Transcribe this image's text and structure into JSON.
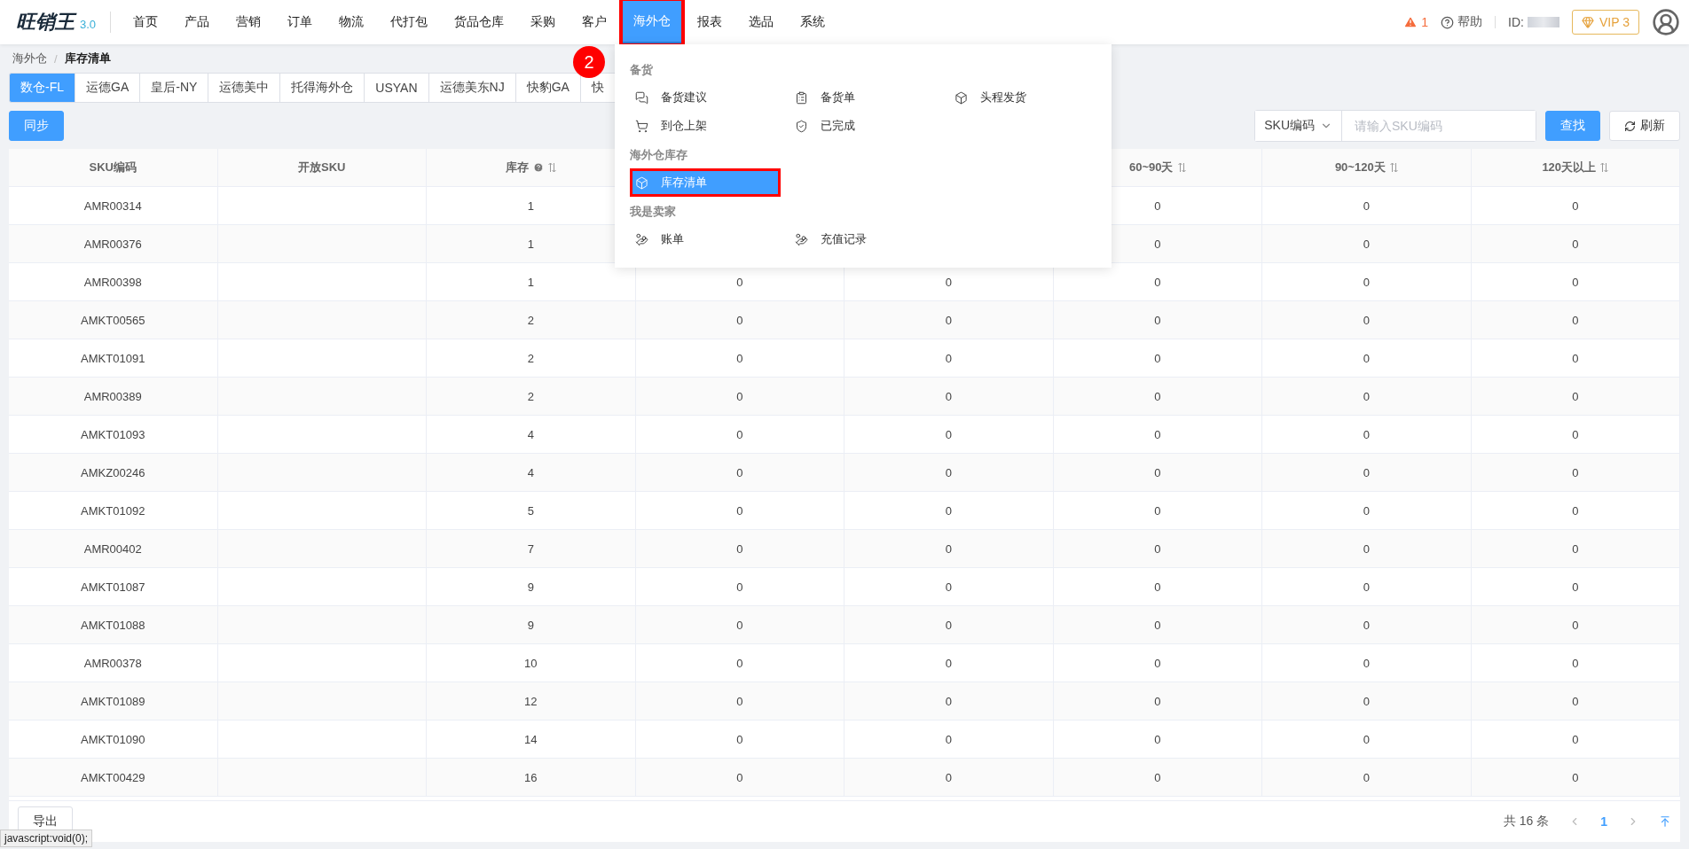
{
  "logo": {
    "name": "旺销王",
    "version": "3.0"
  },
  "nav": [
    {
      "label": "首页",
      "selected": false,
      "annotated": false
    },
    {
      "label": "产品",
      "selected": false,
      "annotated": false
    },
    {
      "label": "营销",
      "selected": false,
      "annotated": false
    },
    {
      "label": "订单",
      "selected": false,
      "annotated": false
    },
    {
      "label": "物流",
      "selected": false,
      "annotated": false
    },
    {
      "label": "代打包",
      "selected": false,
      "annotated": false
    },
    {
      "label": "货品仓库",
      "selected": false,
      "annotated": false
    },
    {
      "label": "采购",
      "selected": false,
      "annotated": false
    },
    {
      "label": "客户",
      "selected": false,
      "annotated": false
    },
    {
      "label": "海外仓",
      "selected": true,
      "annotated": true
    },
    {
      "label": "报表",
      "selected": false,
      "annotated": false
    },
    {
      "label": "选品",
      "selected": false,
      "annotated": false
    },
    {
      "label": "系统",
      "selected": false,
      "annotated": false
    }
  ],
  "annotation_badge": "2",
  "header_right": {
    "alert_count": "1",
    "help": "帮助",
    "id_label": "ID:",
    "vip": "VIP 3"
  },
  "breadcrumb": {
    "items": [
      "海外仓",
      "库存清单"
    ],
    "separator": "/"
  },
  "warehouse_tabs": [
    {
      "label": "数仓-FL",
      "selected": true
    },
    {
      "label": "运德GA",
      "selected": false
    },
    {
      "label": "皇后-NY",
      "selected": false
    },
    {
      "label": "运德美中",
      "selected": false
    },
    {
      "label": "托得海外仓",
      "selected": false
    },
    {
      "label": "USYAN",
      "selected": false
    },
    {
      "label": "运德美东NJ",
      "selected": false
    },
    {
      "label": "快豹GA",
      "selected": false
    },
    {
      "label": "快",
      "selected": false
    }
  ],
  "sync_button": "同步",
  "search": {
    "field": "SKU编码",
    "placeholder": "请输入SKU编码",
    "find": "查找",
    "refresh": "刷新"
  },
  "table": {
    "columns": [
      {
        "label": "SKU编码",
        "sortable": false,
        "help": false
      },
      {
        "label": "开放SKU",
        "sortable": false,
        "help": false
      },
      {
        "label": "库存",
        "sortable": true,
        "help": true
      },
      null,
      null,
      {
        "label": "60~90天",
        "sortable": true,
        "help": false
      },
      {
        "label": "90~120天",
        "sortable": true,
        "help": false
      },
      {
        "label": "120天以上",
        "sortable": true,
        "help": false
      }
    ],
    "rows": [
      {
        "sku": "AMR00314",
        "stock": "1",
        "aging": [
          "0",
          "0",
          "0"
        ]
      },
      {
        "sku": "AMR00376",
        "stock": "1",
        "aging": [
          "0",
          "0",
          "0"
        ]
      },
      {
        "sku": "AMR00398",
        "stock": "1",
        "aging": [
          "0",
          "0",
          "0",
          "0",
          "0"
        ]
      },
      {
        "sku": "AMKT00565",
        "stock": "2",
        "aging": [
          "0",
          "0",
          "0",
          "0",
          "0"
        ]
      },
      {
        "sku": "AMKT01091",
        "stock": "2",
        "aging": [
          "0",
          "0",
          "0",
          "0",
          "0"
        ]
      },
      {
        "sku": "AMR00389",
        "stock": "2",
        "aging": [
          "0",
          "0",
          "0",
          "0",
          "0"
        ]
      },
      {
        "sku": "AMKT01093",
        "stock": "4",
        "aging": [
          "0",
          "0",
          "0",
          "0",
          "0"
        ]
      },
      {
        "sku": "AMKZ00246",
        "stock": "4",
        "aging": [
          "0",
          "0",
          "0",
          "0",
          "0"
        ]
      },
      {
        "sku": "AMKT01092",
        "stock": "5",
        "aging": [
          "0",
          "0",
          "0",
          "0",
          "0"
        ]
      },
      {
        "sku": "AMR00402",
        "stock": "7",
        "aging": [
          "0",
          "0",
          "0",
          "0",
          "0"
        ]
      },
      {
        "sku": "AMKT01087",
        "stock": "9",
        "aging": [
          "0",
          "0",
          "0",
          "0",
          "0"
        ]
      },
      {
        "sku": "AMKT01088",
        "stock": "9",
        "aging": [
          "0",
          "0",
          "0",
          "0",
          "0"
        ]
      },
      {
        "sku": "AMR00378",
        "stock": "10",
        "aging": [
          "0",
          "0",
          "0",
          "0",
          "0"
        ]
      },
      {
        "sku": "AMKT01089",
        "stock": "12",
        "aging": [
          "0",
          "0",
          "0",
          "0",
          "0"
        ]
      },
      {
        "sku": "AMKT01090",
        "stock": "14",
        "aging": [
          "0",
          "0",
          "0",
          "0",
          "0"
        ]
      },
      {
        "sku": "AMKT00429",
        "stock": "16",
        "aging": [
          "0",
          "0",
          "0",
          "0",
          "0"
        ]
      }
    ]
  },
  "footer": {
    "export": "导出",
    "total": "共 16 条",
    "page": "1"
  },
  "status_link": "javascript:void(0);",
  "menu": {
    "sections": [
      {
        "title": "备货",
        "items": [
          {
            "label": "备货建议",
            "selected": false,
            "annotated": false
          },
          {
            "label": "备货单",
            "selected": false,
            "annotated": false
          },
          {
            "label": "头程发货",
            "selected": false,
            "annotated": false
          },
          {
            "label": "到仓上架",
            "selected": false,
            "annotated": false
          },
          {
            "label": "已完成",
            "selected": false,
            "annotated": false
          }
        ]
      },
      {
        "title": "海外仓库存",
        "items": [
          {
            "label": "库存清单",
            "selected": true,
            "annotated": true
          }
        ]
      },
      {
        "title": "我是卖家",
        "items": [
          {
            "label": "账单",
            "selected": false,
            "annotated": false
          },
          {
            "label": "充值记录",
            "selected": false,
            "annotated": false
          }
        ]
      }
    ]
  }
}
